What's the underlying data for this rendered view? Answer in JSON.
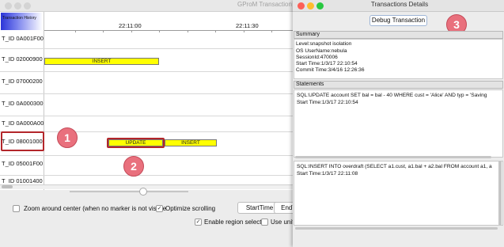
{
  "main": {
    "title": "GProM Transaction Debugger",
    "tx_history": "Transaction History",
    "times": [
      "22:11:00",
      "22:11:30"
    ],
    "rows": [
      "T_ID 0A001F00",
      "T_ID 02000900",
      "T_ID 07000200",
      "T_ID 0A000300",
      "T_ID 0A000A00",
      "T_ID 08001000",
      "T_ID 05001F00",
      "T_ID 01001400"
    ],
    "bars": {
      "insert_label": "INSERT",
      "update_label": "UPDATE",
      "update_insert_label": "INSERT",
      "color": "#ffff00"
    },
    "controls": {
      "zoom_label": "Zoom around center (when no marker is not visible",
      "optimize_label": "Optimize scrolling",
      "optimize_checked": "✓",
      "start_time": "StartTime",
      "end_time": "EndTime",
      "region_label": "Enable region select",
      "region_checked": "✓",
      "unif_label": "Use unifo"
    }
  },
  "annotations": [
    "1",
    "2",
    "3"
  ],
  "details": {
    "title": "Transactions Details",
    "debug_button": "Debug Transaction",
    "summary_header": "Summary",
    "summary_lines": [
      "Level:snapshot isolation",
      "OS UserName:nebula",
      "SessionId:470006",
      "Start Time:1/3/17 22:10:54",
      "Commit Time:3/4/16 12:26:36"
    ],
    "statements_header": "Statements",
    "stmt1_sql": "SQL:UPDATE account SET bal = bal - 40 WHERE cust = 'Alice' AND typ = 'Saving",
    "stmt1_time": "Start Time:1/3/17 22:10:54",
    "stmt2_sql": "SQL:INSERT INTO overdraft (SELECT a1.cust, a1.bal + a2.bal FROM account a1, a",
    "stmt2_time": "Start Time:1/3/17 22:11:08"
  },
  "colors": {
    "badge": "#e9707d",
    "highlight": "#b3262a",
    "bar": "#ffff00"
  }
}
